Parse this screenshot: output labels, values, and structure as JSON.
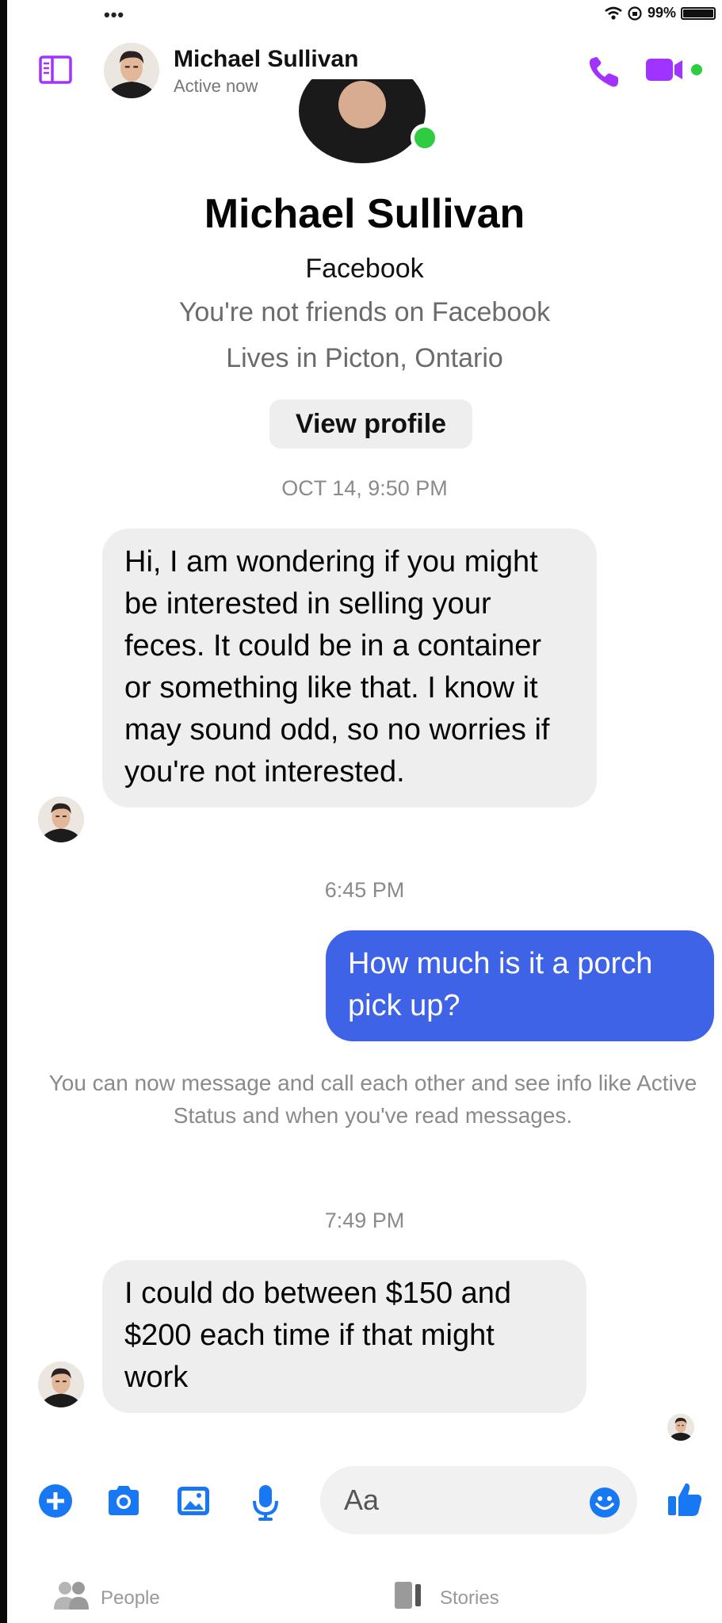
{
  "status_bar": {
    "dots": "•••",
    "battery": "99%",
    "battery_level": 0.99
  },
  "header": {
    "name": "Michael Sullivan",
    "status": "Active now"
  },
  "profile": {
    "name": "Michael Sullivan",
    "network": "Facebook",
    "friend_status": "You're not friends on Facebook",
    "location": "Lives in Picton, Ontario",
    "view_profile": "View profile"
  },
  "thread": {
    "time_1": "OCT 14, 9:50 PM",
    "msg_1": "Hi, I am wondering if you might be interested in selling your feces. It could be in a container or something like that. I know it may sound odd, so no worries if you're not interested.",
    "time_2": "6:45 PM",
    "msg_2": "How much is it a porch pick up?",
    "notice": "You can now message and call each other and see info like Active Status and when you've read messages.",
    "time_3": "7:49 PM",
    "msg_3": "I could do between $150 and $200 each time if that might work"
  },
  "composer": {
    "placeholder": "Aa"
  },
  "nav": {
    "people": "People",
    "stories": "Stories"
  },
  "colors": {
    "accent": "#a033ff",
    "outgoing_bubble": "#3e63e6",
    "icon_blue": "#1877f2",
    "online": "#2ecc40"
  },
  "icons": [
    "sidebar-icon",
    "phone-icon",
    "video-icon",
    "plus-icon",
    "camera-icon",
    "image-icon",
    "microphone-icon",
    "emoji-icon",
    "thumbs-up-icon",
    "people-icon",
    "stories-icon"
  ]
}
